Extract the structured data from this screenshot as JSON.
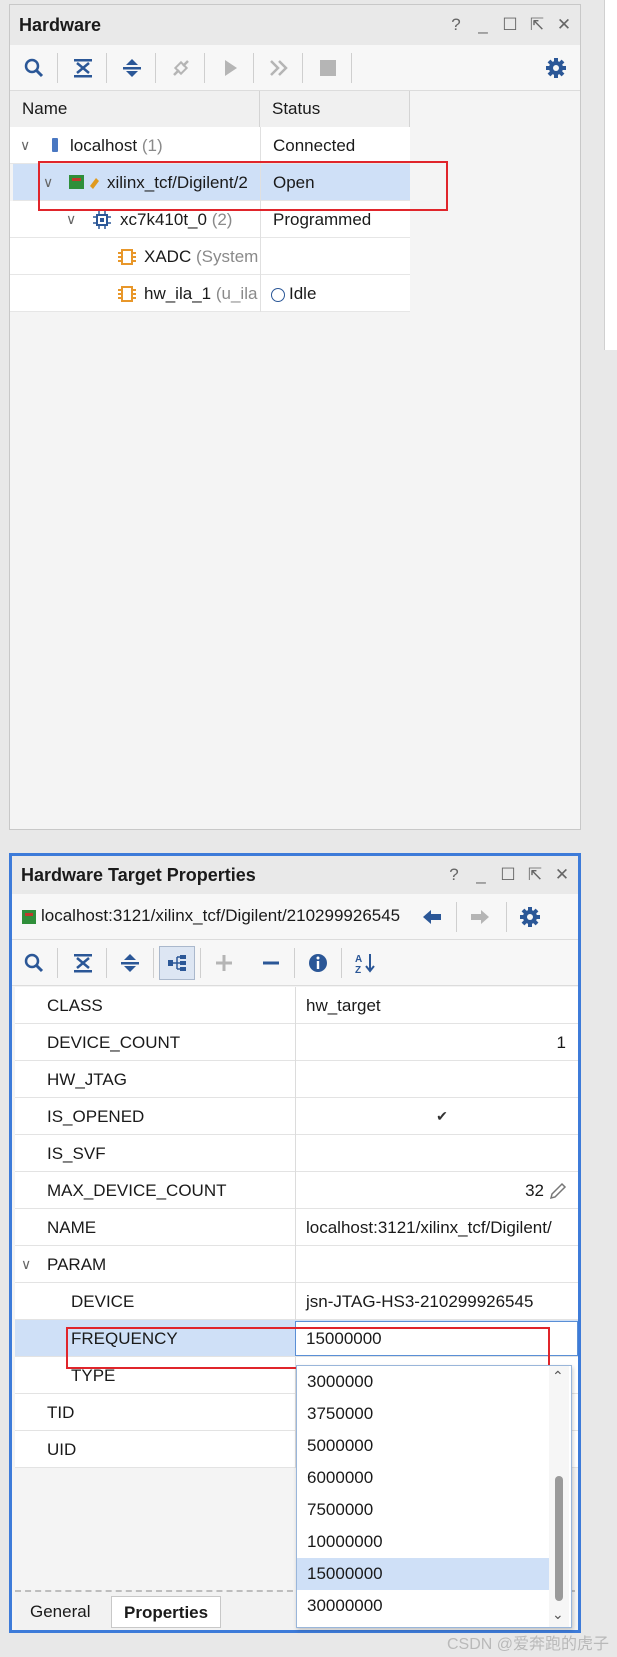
{
  "hardware_panel": {
    "title": "Hardware",
    "window_controls": [
      "?",
      "_",
      "☐",
      "⇱",
      "✕"
    ],
    "columns": [
      "Name",
      "Status"
    ],
    "tree": [
      {
        "name": "localhost",
        "suffix": "(1)",
        "status": "Connected"
      },
      {
        "name": "xilinx_tcf/Digilent/2",
        "suffix": "",
        "status": "Open"
      },
      {
        "name": "xc7k410t_0",
        "suffix": "(2)",
        "status": "Programmed"
      },
      {
        "name": "XADC",
        "suffix": "(System",
        "status": ""
      },
      {
        "name": "hw_ila_1",
        "suffix": "(u_ila",
        "status": "Idle"
      }
    ]
  },
  "props_panel": {
    "title": "Hardware Target Properties",
    "path": "localhost:3121/xilinx_tcf/Digilent/210299926545",
    "properties": [
      {
        "key": "CLASS",
        "value": "hw_target"
      },
      {
        "key": "DEVICE_COUNT",
        "value": "1"
      },
      {
        "key": "HW_JTAG",
        "value": ""
      },
      {
        "key": "IS_OPENED",
        "value": "✔"
      },
      {
        "key": "IS_SVF",
        "value": ""
      },
      {
        "key": "MAX_DEVICE_COUNT",
        "value": "32"
      },
      {
        "key": "NAME",
        "value": "localhost:3121/xilinx_tcf/Digilent/"
      },
      {
        "key": "PARAM",
        "value": ""
      },
      {
        "key": "DEVICE",
        "value": "jsn-JTAG-HS3-210299926545"
      },
      {
        "key": "FREQUENCY",
        "value": "15000000"
      },
      {
        "key": "TYPE",
        "value": ""
      },
      {
        "key": "TID",
        "value": ""
      },
      {
        "key": "UID",
        "value": ""
      }
    ],
    "frequency_options": [
      "3000000",
      "3750000",
      "5000000",
      "6000000",
      "7500000",
      "10000000",
      "15000000",
      "30000000"
    ],
    "selected_frequency": "15000000",
    "tabs": [
      "General",
      "Properties"
    ]
  },
  "watermark": "CSDN @爱奔跑的虎子"
}
